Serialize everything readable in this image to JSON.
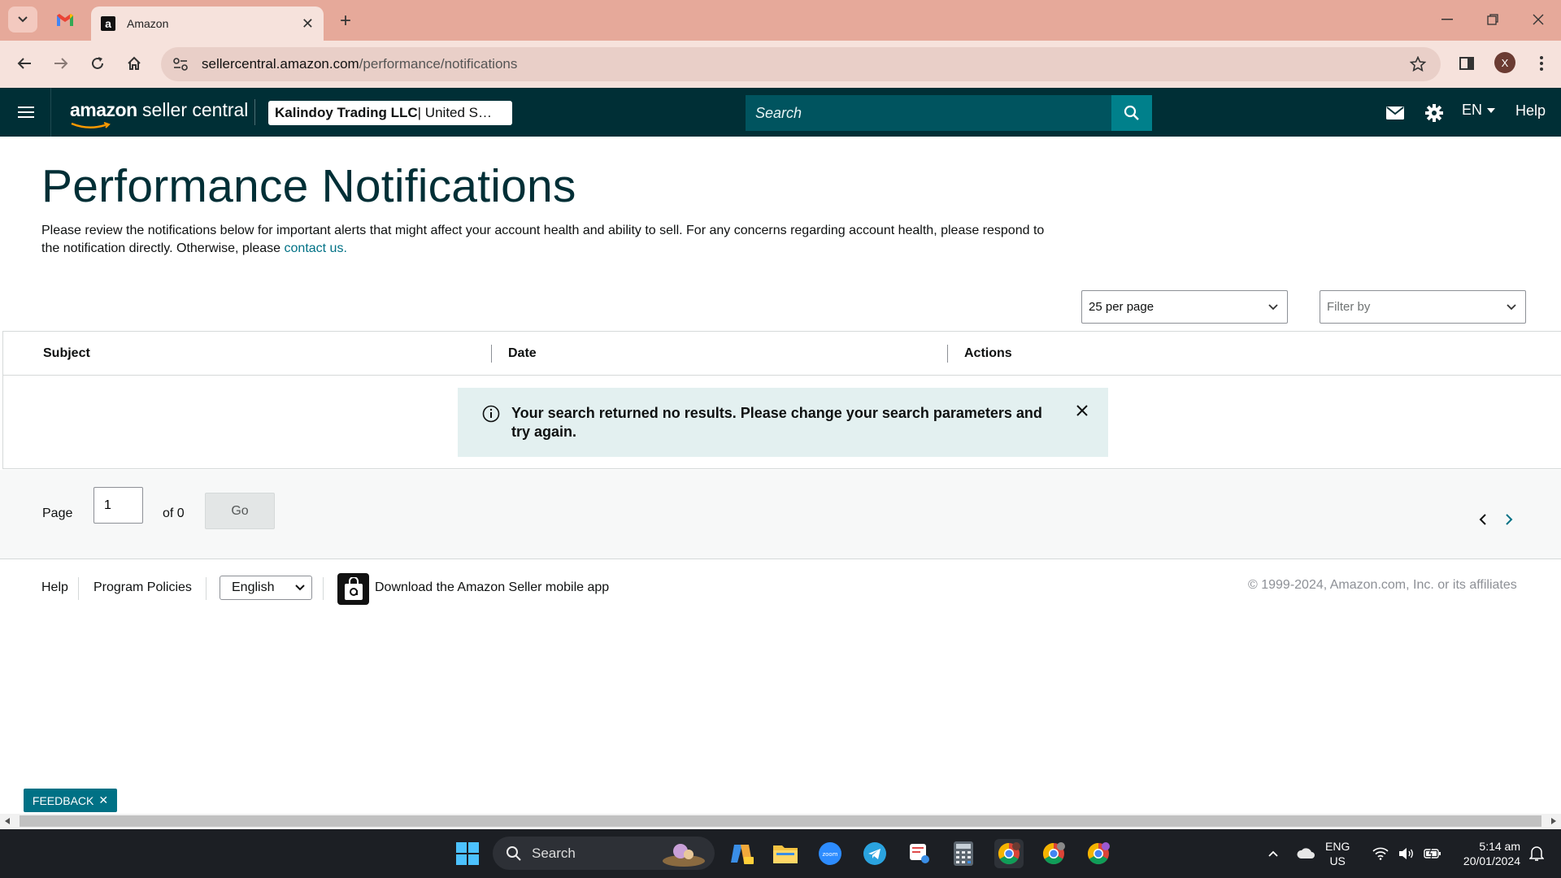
{
  "browser": {
    "active_tab_title": "Amazon",
    "favicon_letter": "a",
    "url_host": "sellercentral.amazon.com",
    "url_path": "/performance/notifications",
    "profile_initial": "X"
  },
  "header": {
    "logo_brand": "amazon",
    "logo_sub": " seller central",
    "merchant_bold": "Kalindoy Trading LLC",
    "merchant_rest": " | United S…",
    "search_placeholder": "Search",
    "language": "EN",
    "help": "Help"
  },
  "page": {
    "title": "Performance Notifications",
    "description": "Please review the notifications below for important alerts that might affect your account health and ability to sell. For any concerns regarding account health, please respond to the notification directly. Otherwise, please ",
    "contact_link": "contact us."
  },
  "controls": {
    "per_page": "25 per page",
    "filter_placeholder": "Filter by"
  },
  "table": {
    "columns": [
      "Subject",
      "Date",
      "Actions"
    ],
    "empty_message": "Your search returned no results. Please change your search parameters and try again."
  },
  "pager": {
    "page_label": "Page",
    "page_value": "1",
    "of_label": "of 0",
    "go_label": "Go"
  },
  "footer": {
    "help": "Help",
    "program_policies": "Program Policies",
    "language": "English",
    "app_download": "Download the Amazon Seller mobile app",
    "copyright": "© 1999-2024, Amazon.com, Inc. or its affiliates"
  },
  "feedback": {
    "label": "FEEDBACK"
  },
  "taskbar": {
    "search_label": "Search",
    "lang_line1": "ENG",
    "lang_line2": "US",
    "time": "5:14 am",
    "date": "20/01/2024"
  },
  "colors": {
    "header_bg": "#002f36",
    "accent": "#007185",
    "tabbar_bg": "#e6a99a"
  }
}
